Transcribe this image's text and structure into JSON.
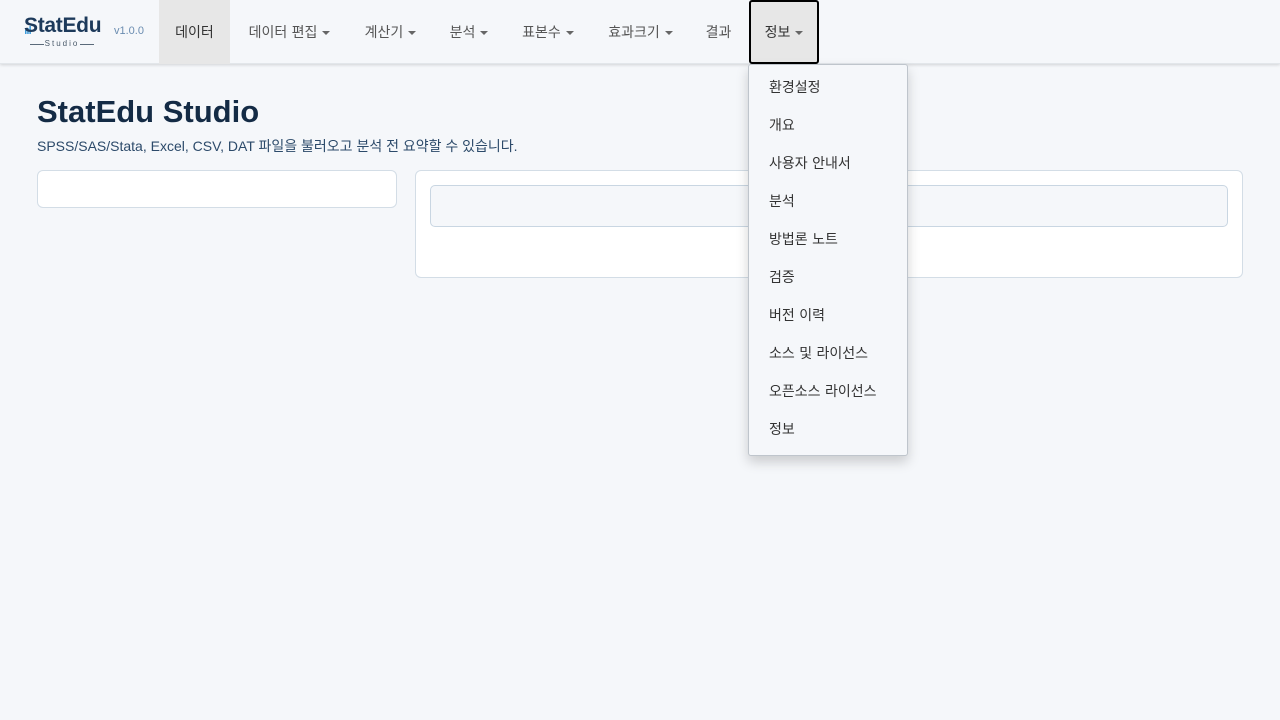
{
  "brand": {
    "name": "StatEdu",
    "sub": "Studio",
    "version": "v1.0.0",
    "colors": {
      "primary": "#1d3a5b",
      "accent": "#3a9ad9"
    }
  },
  "nav": {
    "items": [
      {
        "label": "데이터",
        "state": "active"
      },
      {
        "label": "데이터 편집",
        "dropdown": true
      },
      {
        "label": "계산기",
        "dropdown": true
      },
      {
        "label": "분석",
        "dropdown": true
      },
      {
        "label": "표본수",
        "dropdown": true
      },
      {
        "label": "효과크기",
        "dropdown": true
      },
      {
        "label": "결과"
      },
      {
        "label": "정보",
        "dropdown": true,
        "state": "open"
      }
    ]
  },
  "info_menu": {
    "items": [
      "환경설정",
      "개요",
      "사용자 안내서",
      "분석",
      "방법론 노트",
      "검증",
      "버전 이력",
      "소스 및 라이선스",
      "오픈소스 라이선스",
      "정보"
    ]
  },
  "page": {
    "title": "StatEdu Studio",
    "description": "SPSS/SAS/Stata, Excel, CSV, DAT 파일을 불러오고 분석 전 요약할 수 있습니다."
  }
}
